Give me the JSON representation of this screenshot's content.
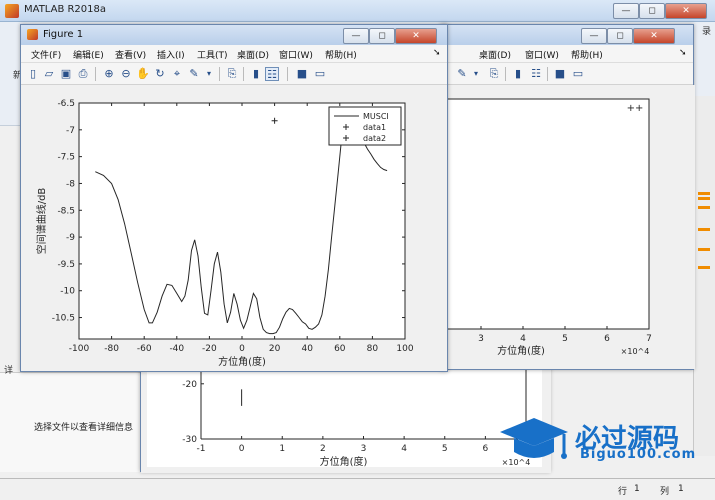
{
  "matlab_window": {
    "title": "MATLAB R2018a",
    "right_clip": "录",
    "left_clip_rows": "新",
    "left_clip_detail": "详",
    "detail_message": "选择文件以查看详细信息"
  },
  "statusbar": {
    "col_label": "行",
    "row_value": "1",
    "line_label": "列",
    "col_value": "1"
  },
  "window_buttons": {
    "minimize": "—",
    "maximize": "◻",
    "close": "✕"
  },
  "figure_menu": [
    "文件(F)",
    "编辑(E)",
    "查看(V)",
    "插入(I)",
    "工具(T)",
    "桌面(D)",
    "窗口(W)",
    "帮助(H)"
  ],
  "menu_arrow": "➘",
  "figure1": {
    "title": "Figure 1"
  },
  "icons": [
    "new-figure-icon",
    "open-icon",
    "save-icon",
    "print-icon",
    "zoom-in-icon",
    "zoom-out-icon",
    "pan-icon",
    "rotate-icon",
    "data-cursor-icon",
    "brush-icon",
    "brush-dropdown-icon",
    "link-plot-icon",
    "colorbar-icon",
    "legend-icon",
    "hide-plot-tools-icon",
    "show-plot-tools-icon"
  ],
  "watermark": {
    "text_cn": "必过源码",
    "text_en": "Biguo100.com"
  },
  "chart_data": [
    {
      "type": "line",
      "name": "figure1-axes",
      "xlabel": "方位角(度)",
      "ylabel": "空间谱曲线/dB",
      "xlim": [
        -100,
        100
      ],
      "ylim": [
        -10.9,
        -6.5
      ],
      "xticks": [
        -100,
        -80,
        -60,
        -40,
        -20,
        0,
        20,
        40,
        60,
        80,
        100
      ],
      "yticks": [
        -6.5,
        -7,
        -7.5,
        -8,
        -8.5,
        -9,
        -9.5,
        -10,
        -10.5
      ],
      "legend": {
        "location": "top-right",
        "entries": [
          "MUSCI",
          "data1",
          "data2"
        ]
      },
      "series": [
        {
          "name": "MUSCI",
          "style": "line",
          "x": [
            -90,
            -85,
            -80,
            -76,
            -72,
            -68,
            -64,
            -60,
            -57,
            -55,
            -52,
            -49,
            -46,
            -43,
            -40,
            -37,
            -35,
            -33,
            -31,
            -29,
            -27,
            -25,
            -23,
            -21,
            -19,
            -17,
            -15,
            -13,
            -11,
            -9,
            -7,
            -5,
            -3,
            -1,
            1,
            3,
            5,
            7,
            9,
            11,
            13,
            15,
            17,
            19,
            21,
            23,
            25,
            27,
            29,
            31,
            33,
            35,
            37,
            39,
            41,
            43,
            45,
            47,
            49,
            51,
            53,
            55,
            57,
            59,
            61,
            63,
            65,
            67,
            69,
            71,
            73,
            75,
            77,
            79,
            81,
            83,
            85,
            87,
            89
          ],
          "y": [
            -7.78,
            -7.85,
            -8.0,
            -8.3,
            -8.75,
            -9.3,
            -9.85,
            -10.35,
            -10.6,
            -10.6,
            -10.4,
            -10.1,
            -9.88,
            -9.9,
            -10.05,
            -10.2,
            -10.1,
            -9.8,
            -9.25,
            -9.05,
            -9.35,
            -9.95,
            -10.42,
            -10.45,
            -10.0,
            -9.5,
            -9.28,
            -9.65,
            -10.25,
            -10.6,
            -10.4,
            -10.05,
            -10.25,
            -10.55,
            -10.7,
            -10.55,
            -10.3,
            -10.05,
            -10.15,
            -10.5,
            -10.72,
            -10.78,
            -10.8,
            -10.8,
            -10.78,
            -10.68,
            -10.52,
            -10.4,
            -10.33,
            -10.35,
            -10.42,
            -10.5,
            -10.58,
            -10.62,
            -10.7,
            -10.72,
            -10.68,
            -10.62,
            -10.45,
            -10.1,
            -9.6,
            -9.0,
            -8.4,
            -7.8,
            -7.2,
            -6.92,
            -6.85,
            -6.88,
            -6.96,
            -7.05,
            -7.15,
            -7.25,
            -7.36,
            -7.45,
            -7.55,
            -7.63,
            -7.7,
            -7.74,
            -7.76
          ]
        },
        {
          "name": "data1",
          "style": "marker-plus",
          "x": [
            20
          ],
          "y": [
            -6.83
          ]
        },
        {
          "name": "data2",
          "style": "marker-plus",
          "x": [],
          "y": []
        }
      ]
    },
    {
      "type": "line",
      "name": "figure-right-axes",
      "xlabel": "方位角(度)",
      "x_exponent": "×10^4",
      "xticks": [
        3,
        4,
        5,
        6,
        7
      ],
      "legend": {
        "entries": [
          "++"
        ]
      }
    },
    {
      "type": "line",
      "name": "figure-back-axes",
      "xlabel": "方位角(度)",
      "x_exponent": "×10^4",
      "xlim": [
        -1,
        7
      ],
      "xticks": [
        -1,
        0,
        1,
        2,
        3,
        4,
        5,
        6,
        7
      ],
      "yticks": [
        -20,
        -30
      ],
      "series": [
        {
          "name": "",
          "style": "line",
          "x": [
            0,
            0
          ],
          "y": [
            -21,
            -24
          ]
        }
      ]
    }
  ]
}
